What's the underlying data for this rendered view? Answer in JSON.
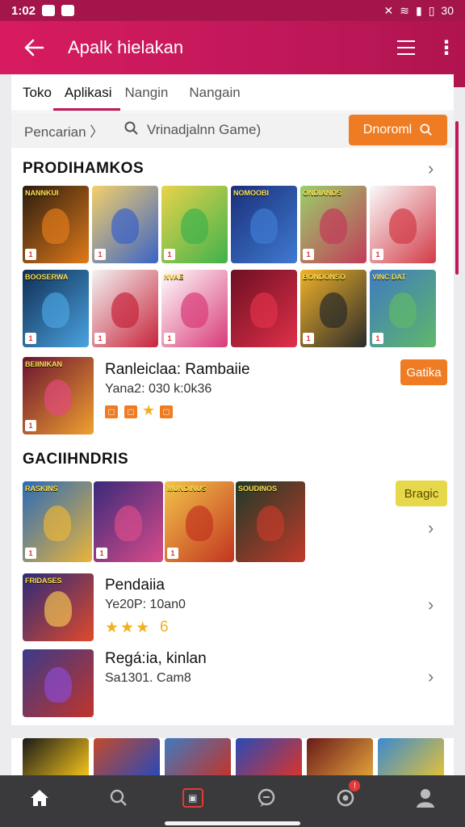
{
  "status": {
    "time": "1:02",
    "battery": "30"
  },
  "appbar": {
    "title": "Apalk hielakan"
  },
  "tabs": [
    "Toko",
    "Aplikasi",
    "Nangin",
    "Nangain"
  ],
  "search": {
    "crumb": "Pencarian 〉",
    "query": "Vrinadjalnn Game)",
    "button": "Dnoroml"
  },
  "section1": {
    "title": "PRODIHAMKOS",
    "tiles_row1": [
      {
        "label": "NANNKUI",
        "badge": "1",
        "c1": "#2a1c10",
        "c2": "#e07a1a"
      },
      {
        "label": "",
        "badge": "1",
        "c1": "#f3d06a",
        "c2": "#3a63c7"
      },
      {
        "label": "",
        "badge": "1",
        "c1": "#e9d34a",
        "c2": "#3fb24d"
      },
      {
        "label": "NOMOOBI",
        "badge": "",
        "c1": "#1a2f7a",
        "c2": "#3f7ad1"
      },
      {
        "label": "ONDIANDS",
        "badge": "1",
        "c1": "#9ad06a",
        "c2": "#c23b5a"
      },
      {
        "label": "",
        "badge": "1",
        "c1": "#fafafa",
        "c2": "#d23b46"
      }
    ],
    "tiles_row2": [
      {
        "label": "BOOSERWA",
        "badge": "1",
        "c1": "#0f2d53",
        "c2": "#4aa3e0"
      },
      {
        "label": "",
        "badge": "1",
        "c1": "#f3f3f3",
        "c2": "#c7243a"
      },
      {
        "label": "NVAE",
        "badge": "1",
        "c1": "#ffffff",
        "c2": "#d83a78"
      },
      {
        "label": "",
        "badge": "",
        "c1": "#6d0f22",
        "c2": "#e0304a"
      },
      {
        "label": "BONDONSO",
        "badge": "1",
        "c1": "#f0b22a",
        "c2": "#2a2a2a"
      },
      {
        "label": "VINC DAT",
        "badge": "1",
        "c1": "#3f7ac0",
        "c2": "#5fb86a"
      }
    ],
    "featured": {
      "tile_label": "BEIINIKAN",
      "name": "Ranleiclaa: Rambaiie",
      "sub": "Yana2: 030 k:0k36",
      "button": "Gatika"
    }
  },
  "section2": {
    "title": "GACIIHNDRIS",
    "tiles": [
      {
        "label": "RASKINS",
        "badge": "1",
        "c1": "#2a6ab8",
        "c2": "#e9b43a"
      },
      {
        "label": "",
        "badge": "1",
        "c1": "#3a2a7a",
        "c2": "#d84b8a"
      },
      {
        "label": "MUNDINUS",
        "badge": "1",
        "c1": "#f2c44a",
        "c2": "#c2341f"
      },
      {
        "label": "SOUDINOS",
        "badge": "",
        "c1": "#1e3a28",
        "c2": "#c23a2a"
      }
    ],
    "button": "Bragic",
    "items": [
      {
        "name": "Pendaiia",
        "sub": "Ye20P: 10an0",
        "rating": "★★★",
        "rating_num": "6",
        "tile_label": "FRIDASES"
      },
      {
        "name": "Regá:ia, kinlan",
        "sub": "Sa1301. Cam8",
        "tile_label": ""
      }
    ]
  },
  "nav": [
    "home",
    "search",
    "store",
    "chat",
    "notifications",
    "profile"
  ],
  "nav_badge": "!"
}
